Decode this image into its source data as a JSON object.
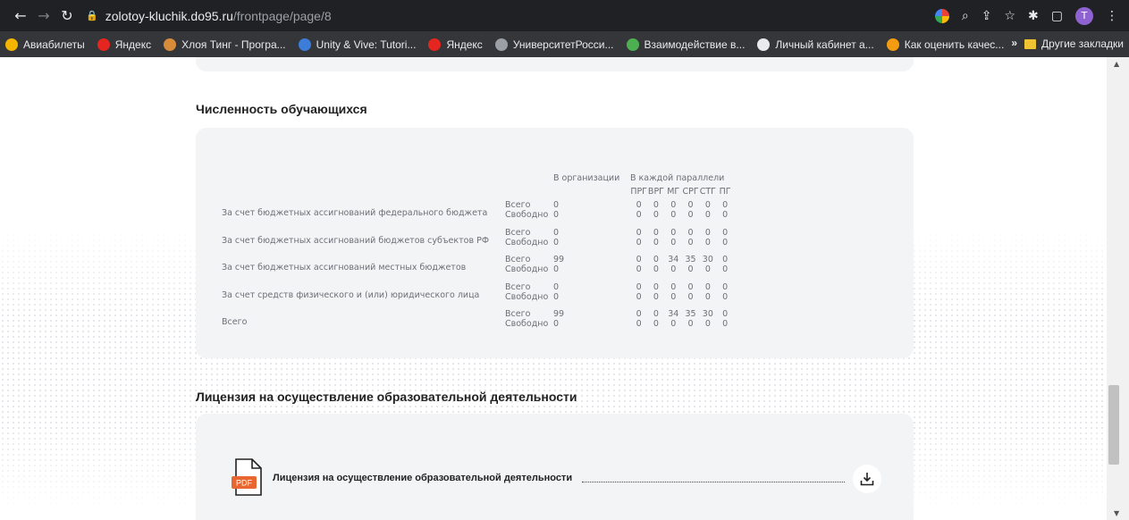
{
  "browser": {
    "url_host": "zolotoy-kluchik.do95.ru",
    "url_path": "/frontpage/page/8",
    "profile_initial": "T",
    "bookmarks": [
      {
        "label": "Авиабилеты",
        "color": "#f4b400"
      },
      {
        "label": "Яндекс",
        "color": "#e52620"
      },
      {
        "label": "Хлоя Тинг - Програ...",
        "color": "#d88c3a"
      },
      {
        "label": "Unity & Vive: Tutori...",
        "color": "#3b7dd8"
      },
      {
        "label": "Яндекс",
        "color": "#e52620"
      },
      {
        "label": "УниверситетРосси...",
        "color": "#9aa0a6"
      },
      {
        "label": "Взаимодействие в...",
        "color": "#4caf50"
      },
      {
        "label": "Личный кабинет а...",
        "color": "#e8eaed"
      },
      {
        "label": "Как оценить качес...",
        "color": "#f39c12"
      }
    ],
    "bookmarks_more": "»",
    "other_bookmarks": "Другие закладки"
  },
  "page": {
    "section1_title": "Численность обучающихся",
    "section2_title": "Лицензия на осуществление образовательной деятельности",
    "table": {
      "header_org": "В организации",
      "header_parallel": "В каждой параллели",
      "groups": [
        "ПРГ",
        "ВРГ",
        "МГ",
        "СРГ",
        "СТГ",
        "ПГ"
      ],
      "rows": [
        {
          "label": "За счет бюджетных ассигнований федерального бюджета",
          "total_kind": "Всего",
          "total_org": "0",
          "total_vals": [
            "0",
            "0",
            "0",
            "0",
            "0",
            "0"
          ],
          "free_kind": "Свободно",
          "free_org": "0",
          "free_vals": [
            "0",
            "0",
            "0",
            "0",
            "0",
            "0"
          ]
        },
        {
          "label": "За счет бюджетных ассигнований бюджетов субъектов РФ",
          "total_kind": "Всего",
          "total_org": "0",
          "total_vals": [
            "0",
            "0",
            "0",
            "0",
            "0",
            "0"
          ],
          "free_kind": "Свободно",
          "free_org": "0",
          "free_vals": [
            "0",
            "0",
            "0",
            "0",
            "0",
            "0"
          ]
        },
        {
          "label": "За счет бюджетных ассигнований местных бюджетов",
          "total_kind": "Всего",
          "total_org": "99",
          "total_vals": [
            "0",
            "0",
            "34",
            "35",
            "30",
            "0"
          ],
          "free_kind": "Свободно",
          "free_org": "0",
          "free_vals": [
            "0",
            "0",
            "0",
            "0",
            "0",
            "0"
          ]
        },
        {
          "label": "За счет средств физического и (или) юридического лица",
          "total_kind": "Всего",
          "total_org": "0",
          "total_vals": [
            "0",
            "0",
            "0",
            "0",
            "0",
            "0"
          ],
          "free_kind": "Свободно",
          "free_org": "0",
          "free_vals": [
            "0",
            "0",
            "0",
            "0",
            "0",
            "0"
          ]
        },
        {
          "label": "Всего",
          "total_kind": "Всего",
          "total_org": "99",
          "total_vals": [
            "0",
            "0",
            "34",
            "35",
            "30",
            "0"
          ],
          "free_kind": "Свободно",
          "free_org": "0",
          "free_vals": [
            "0",
            "0",
            "0",
            "0",
            "0",
            "0"
          ]
        }
      ]
    },
    "license": {
      "pdf_label": "PDF",
      "link_text": "Лицензия на осуществление образовательной деятельности"
    }
  }
}
